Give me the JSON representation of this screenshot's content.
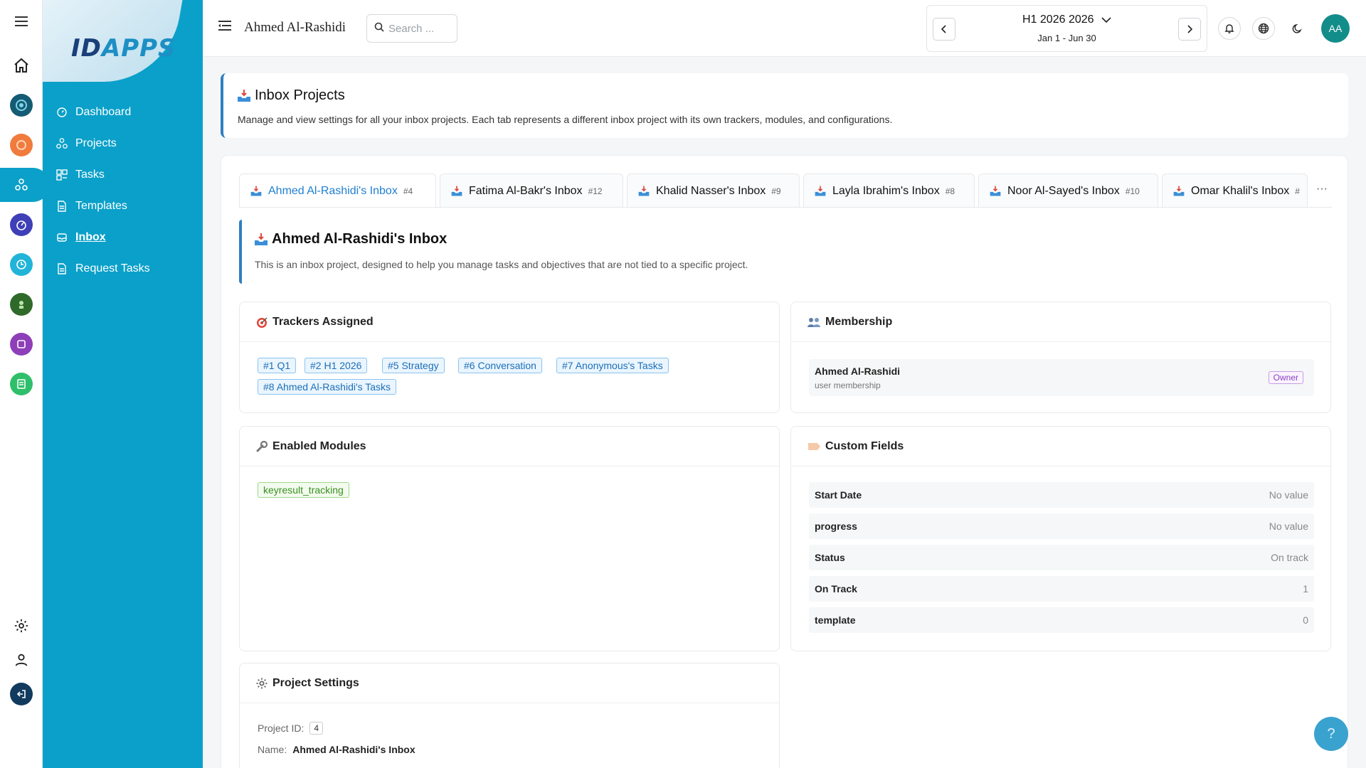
{
  "header": {
    "user_name": "Ahmed Al-Rashidi",
    "search_placeholder": "Search ...",
    "period_title": "H1 2026 2026",
    "period_range": "Jan 1 - Jun 30",
    "avatar_initials": "AA"
  },
  "sidebar": {
    "logo_prefix": "ID",
    "logo_suffix": "APPS",
    "items": [
      {
        "label": "Dashboard",
        "icon": "dashboard-icon"
      },
      {
        "label": "Projects",
        "icon": "projects-icon"
      },
      {
        "label": "Tasks",
        "icon": "tasks-icon"
      },
      {
        "label": "Templates",
        "icon": "templates-icon"
      },
      {
        "label": "Inbox",
        "icon": "inbox-icon",
        "active": true
      },
      {
        "label": "Request Tasks",
        "icon": "request-tasks-icon"
      }
    ]
  },
  "page": {
    "title": "Inbox Projects",
    "description": "Manage and view settings for all your inbox projects. Each tab represents a different inbox project with its own trackers, modules, and configurations."
  },
  "tabs": [
    {
      "label": "Ahmed Al-Rashidi's Inbox",
      "num": "#4",
      "active": true
    },
    {
      "label": "Fatima Al-Bakr's Inbox",
      "num": "#12"
    },
    {
      "label": "Khalid Nasser's Inbox",
      "num": "#9"
    },
    {
      "label": "Layla Ibrahim's Inbox",
      "num": "#8"
    },
    {
      "label": "Noor Al-Sayed's Inbox",
      "num": "#10"
    },
    {
      "label": "Omar Khalil's Inbox",
      "num": "#"
    }
  ],
  "tabs_more": "···",
  "inbox": {
    "title": "Ahmed Al-Rashidi's Inbox",
    "description": "This is an inbox project, designed to help you manage tasks and objectives that are not tied to a specific project."
  },
  "trackers": {
    "title": "Trackers Assigned",
    "items": [
      "#1 Q1",
      "#2 H1 2026",
      "#5 Strategy",
      "#6 Conversation",
      "#7 Anonymous's Tasks",
      "#8 Ahmed Al-Rashidi's Tasks"
    ]
  },
  "membership": {
    "title": "Membership",
    "name": "Ahmed Al-Rashidi",
    "type": "user membership",
    "role": "Owner"
  },
  "modules": {
    "title": "Enabled Modules",
    "items": [
      "keyresult_tracking"
    ]
  },
  "custom_fields": {
    "title": "Custom Fields",
    "rows": [
      {
        "key": "Start Date",
        "value": "No value"
      },
      {
        "key": "progress",
        "value": "No value"
      },
      {
        "key": "Status",
        "value": "On track"
      },
      {
        "key": "On Track",
        "value": "1"
      },
      {
        "key": "template",
        "value": "0"
      }
    ]
  },
  "settings": {
    "title": "Project Settings",
    "id_label": "Project ID",
    "id_value": "4",
    "name_label": "Name",
    "name_value": "Ahmed Al-Rashidi's Inbox"
  },
  "help_label": "?",
  "colors": {
    "sidebar": "#0aa0c9",
    "accent_blue": "#2f7fc1",
    "tab_active": "#1f7fd1",
    "avatar": "#138d8a"
  }
}
